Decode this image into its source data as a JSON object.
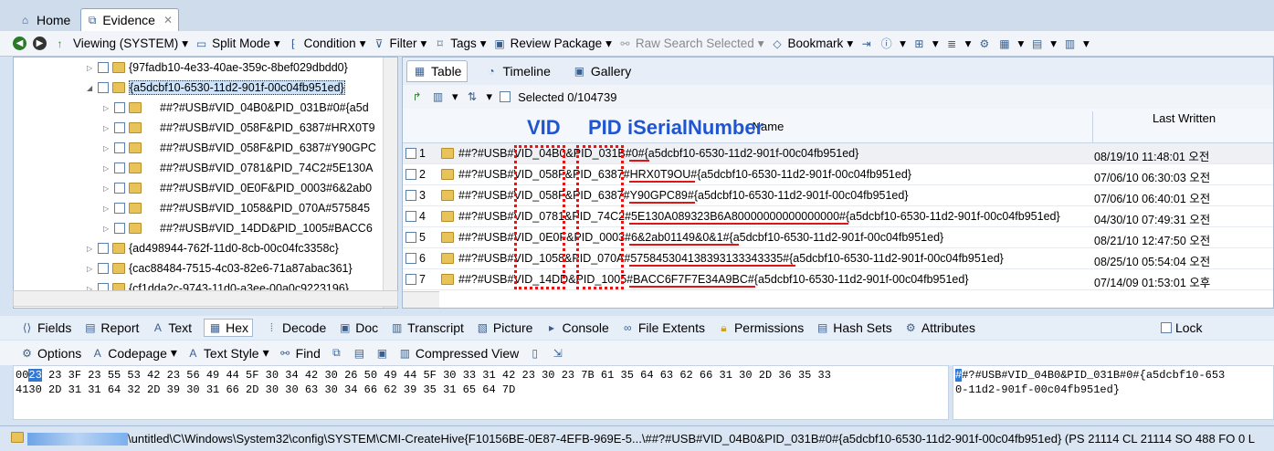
{
  "tabs": [
    {
      "label": "Home"
    },
    {
      "label": "Evidence"
    }
  ],
  "toolbar": {
    "viewing": "Viewing (SYSTEM)",
    "split_mode": "Split Mode",
    "condition": "Condition",
    "filter": "Filter",
    "tags": "Tags",
    "review_package": "Review Package",
    "raw_search": "Raw Search Selected",
    "bookmark": "Bookmark"
  },
  "tree": [
    {
      "label": "{97fadb10-4e33-40ae-359c-8bef029dbdd0}"
    },
    {
      "label": "{a5dcbf10-6530-11d2-901f-00c04fb951ed}"
    },
    {
      "label": "##?#USB#VID_04B0&PID_031B#0#{a5d"
    },
    {
      "label": "##?#USB#VID_058F&PID_6387#HRX0T9"
    },
    {
      "label": "##?#USB#VID_058F&PID_6387#Y90GPC"
    },
    {
      "label": "##?#USB#VID_0781&PID_74C2#5E130A"
    },
    {
      "label": "##?#USB#VID_0E0F&PID_0003#6&2ab0"
    },
    {
      "label": "##?#USB#VID_1058&PID_070A#575845"
    },
    {
      "label": "##?#USB#VID_14DD&PID_1005#BACC6"
    },
    {
      "label": "{ad498944-762f-11d0-8cb-00c04fc3358c}"
    },
    {
      "label": "{cac88484-7515-4c03-82e6-71a87abac361}"
    },
    {
      "label": "{cf1dda2c-9743-11d0-a3ee-00a0c9223196}"
    }
  ],
  "view_tabs": [
    {
      "label": "Table"
    },
    {
      "label": "Timeline"
    },
    {
      "label": "Gallery"
    }
  ],
  "selected_count": "Selected 0/104739",
  "grid": {
    "col_name": "Name",
    "col_date": "Last Written",
    "rows": [
      {
        "num": "1",
        "name": "##?#USB#VID_04B0&PID_031B#0#{a5dcbf10-6530-11d2-901f-00c04fb951ed}",
        "date": "08/19/10 11:48:01 오전"
      },
      {
        "num": "2",
        "name": "##?#USB#VID_058F&PID_6387#HRX0T9OU#{a5dcbf10-6530-11d2-901f-00c04fb951ed}",
        "date": "07/06/10 06:30:03 오전"
      },
      {
        "num": "3",
        "name": "##?#USB#VID_058F&PID_6387#Y90GPC89#{a5dcbf10-6530-11d2-901f-00c04fb951ed}",
        "date": "07/06/10 06:40:01 오전"
      },
      {
        "num": "4",
        "name": "##?#USB#VID_0781&PID_74C2#5E130A089323B6A80000000000000000#{a5dcbf10-6530-11d2-901f-00c04fb951ed}",
        "date": "04/30/10 07:49:31 오전"
      },
      {
        "num": "5",
        "name": "##?#USB#VID_0E0F&PID_0003#6&2ab01149&0&1#{a5dcbf10-6530-11d2-901f-00c04fb951ed}",
        "date": "08/21/10 12:47:50 오전"
      },
      {
        "num": "6",
        "name": "##?#USB#VID_1058&PID_070A#575845304138393133343335#{a5dcbf10-6530-11d2-901f-00c04fb951ed}",
        "date": "08/25/10 05:54:04 오전"
      },
      {
        "num": "7",
        "name": "##?#USB#VID_14DD&PID_1005#BACC6F7F7E34A9BC#{a5dcbf10-6530-11d2-901f-00c04fb951ed}",
        "date": "07/14/09 01:53:01 오후"
      }
    ]
  },
  "annotations": {
    "vid": "VID",
    "pid": "PID",
    "serial": "iSerialNumber"
  },
  "bottom_tabs": [
    {
      "label": "Fields"
    },
    {
      "label": "Report"
    },
    {
      "label": "Text"
    },
    {
      "label": "Hex"
    },
    {
      "label": "Decode"
    },
    {
      "label": "Doc"
    },
    {
      "label": "Transcript"
    },
    {
      "label": "Picture"
    },
    {
      "label": "Console"
    },
    {
      "label": "File Extents"
    },
    {
      "label": "Permissions"
    },
    {
      "label": "Hash Sets"
    },
    {
      "label": "Attributes"
    }
  ],
  "lock_label": "Lock",
  "options": {
    "options": "Options",
    "codepage": "Codepage",
    "text_style": "Text Style",
    "find": "Find",
    "compressed_view": "Compressed View"
  },
  "hex": {
    "line1_offset": "00",
    "line1_first": "23",
    "line1_rest": " 23 3F 23 55 53 42 23 56 49 44 5F 30 34 42 30 26 50 49 44 5F 30 33 31 42 23 30 23 7B 61 35 64 63 62 66 31 30 2D 36 35 33",
    "line2_offset": "41",
    "line2": "30 2D 31 31 64 32 2D 39 30 31 66 2D 30 30 63 30 34 66 62 39 35 31 65 64 7D",
    "ascii1_first": "#",
    "ascii1": "#?#USB#VID_04B0&PID_031B#0#{a5dcbf10-653",
    "ascii2": "0-11d2-901f-00c04fb951ed}"
  },
  "status": "\\untitled\\C\\Windows\\System32\\config\\SYSTEM\\CMI-CreateHive{F10156BE-0E87-4EFB-969E-5...\\##?#USB#VID_04B0&PID_031B#0#{a5dcbf10-6530-11d2-901f-00c04fb951ed} (PS 21114 CL 21114 SO 488 FO 0 L"
}
